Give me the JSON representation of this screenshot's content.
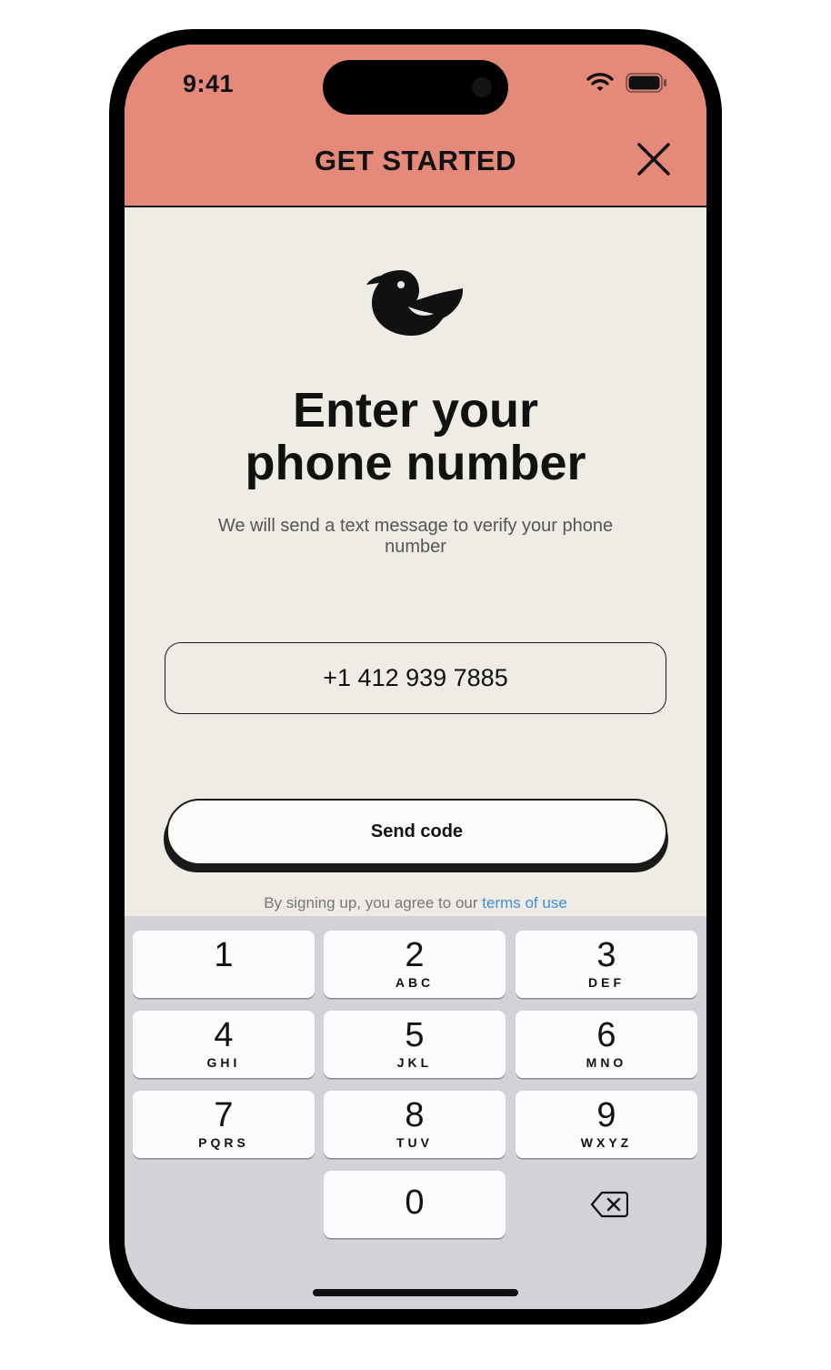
{
  "status_bar": {
    "time": "9:41"
  },
  "header": {
    "title": "GET STARTED"
  },
  "main": {
    "heading_line1": "Enter your",
    "heading_line2": "phone number",
    "subtitle": "We will send a text message to verify your phone number",
    "phone_value": "+1 412 939 7885",
    "send_label": "Send code",
    "terms_prefix": "By signing up, you agree to our ",
    "terms_link": "terms of use"
  },
  "keypad": {
    "keys": [
      {
        "num": "1",
        "letters": ""
      },
      {
        "num": "2",
        "letters": "ABC"
      },
      {
        "num": "3",
        "letters": "DEF"
      },
      {
        "num": "4",
        "letters": "GHI"
      },
      {
        "num": "5",
        "letters": "JKL"
      },
      {
        "num": "6",
        "letters": "MNO"
      },
      {
        "num": "7",
        "letters": "PQRS"
      },
      {
        "num": "8",
        "letters": "TUV"
      },
      {
        "num": "9",
        "letters": "WXYZ"
      },
      {
        "num": "0",
        "letters": ""
      }
    ]
  },
  "colors": {
    "header": "#e5897a",
    "background": "#efece6",
    "link": "#3f8edc",
    "keyboard": "#d2d3d8"
  },
  "icons": [
    "wifi-icon",
    "battery-icon",
    "close-icon",
    "bird-logo-icon",
    "backspace-icon"
  ]
}
